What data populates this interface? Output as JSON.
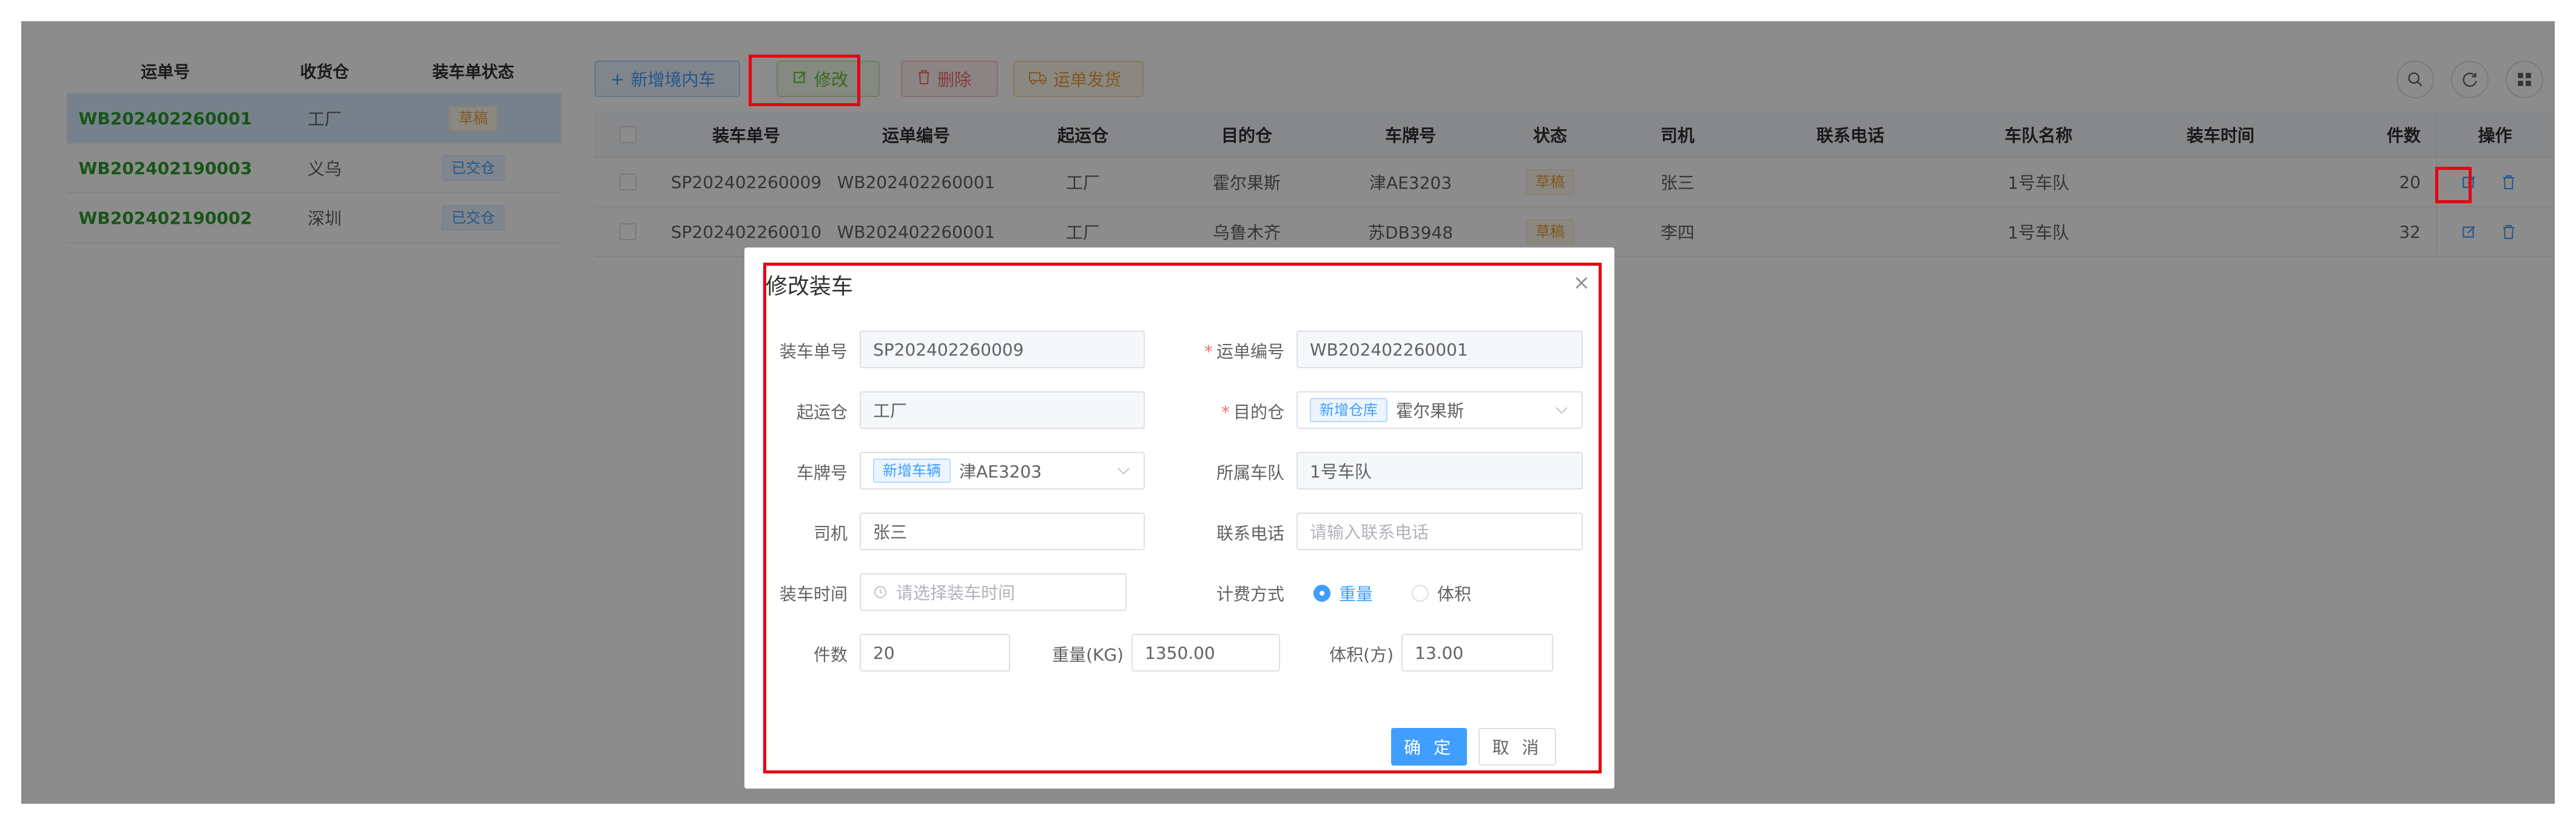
{
  "left_list": {
    "headers": [
      "运单号",
      "收货仓",
      "装车单状态"
    ],
    "rows": [
      {
        "code": "WB202402260001",
        "warehouse": "工厂",
        "status": "草稿"
      },
      {
        "code": "WB202402190003",
        "warehouse": "义乌",
        "status": "已交仓"
      },
      {
        "code": "WB202402190002",
        "warehouse": "深圳",
        "status": "已交仓"
      }
    ]
  },
  "toolbar": {
    "add_label": "新增境内车",
    "edit_label": "修改",
    "delete_label": "删除",
    "ship_label": "运单发货"
  },
  "table": {
    "headers": [
      "装车单号",
      "运单编号",
      "起运仓",
      "目的仓",
      "车牌号",
      "状态",
      "司机",
      "联系电话",
      "车队名称",
      "装车时间",
      "件数",
      "操作"
    ],
    "rows": [
      {
        "load_no": "SP202402260009",
        "waybill_no": "WB202402260001",
        "origin": "工厂",
        "dest": "霍尔果斯",
        "plate": "津AE3203",
        "status": "草稿",
        "driver": "张三",
        "phone": "",
        "fleet": "1号车队",
        "load_time": "",
        "count": "20"
      },
      {
        "load_no": "SP202402260010",
        "waybill_no": "WB202402260001",
        "origin": "工厂",
        "dest": "乌鲁木齐",
        "plate": "苏DB3948",
        "status": "草稿",
        "driver": "李四",
        "phone": "",
        "fleet": "1号车队",
        "load_time": "",
        "count": "32"
      }
    ]
  },
  "dialog": {
    "title": "修改装车",
    "close_glyph": "×",
    "fields": {
      "load_no": {
        "label": "装车单号",
        "value": "SP202402260009"
      },
      "waybill_no": {
        "label": "运单编号",
        "value": "WB202402260001"
      },
      "origin": {
        "label": "起运仓",
        "value": "工厂"
      },
      "dest": {
        "label": "目的仓",
        "tag": "新增仓库",
        "value": "霍尔果斯"
      },
      "plate": {
        "label": "车牌号",
        "tag": "新增车辆",
        "value": "津AE3203"
      },
      "fleet": {
        "label": "所属车队",
        "value": "1号车队"
      },
      "driver": {
        "label": "司机",
        "value": "张三"
      },
      "phone": {
        "label": "联系电话",
        "placeholder": "请输入联系电话"
      },
      "load_time": {
        "label": "装车时间",
        "placeholder": "请选择装车时间"
      },
      "billing": {
        "label": "计费方式",
        "options": [
          "重量",
          "体积"
        ],
        "selected": "重量"
      },
      "count": {
        "label": "件数",
        "value": "20"
      },
      "weight": {
        "label": "重量(KG)",
        "value": "1350.00"
      },
      "volume": {
        "label": "体积(方)",
        "value": "13.00"
      }
    },
    "ok_label": "确 定",
    "cancel_label": "取 消"
  },
  "colors": {
    "primary": "#409eff",
    "success": "#67c23a",
    "danger": "#f56c6c",
    "warning": "#e6a23c",
    "highlight": "#e60012"
  }
}
